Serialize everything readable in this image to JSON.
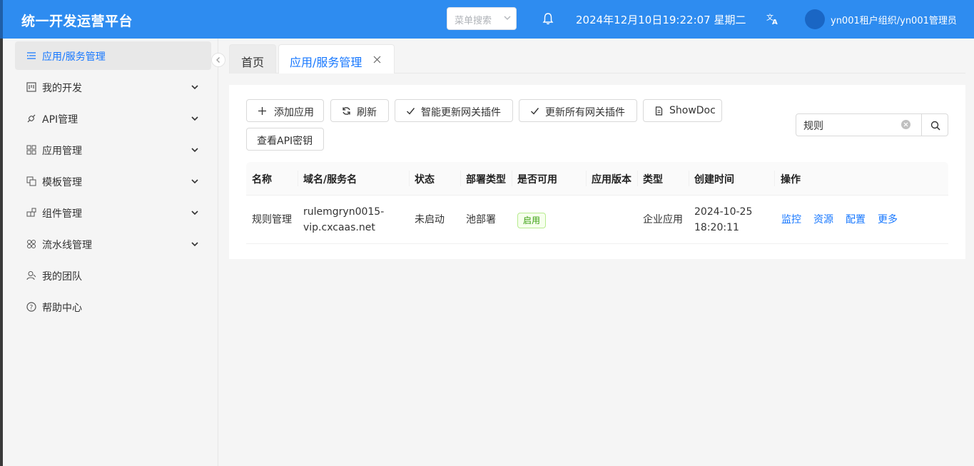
{
  "header": {
    "brand": "统一开发运营平台",
    "menu_search_placeholder": "菜单搜索",
    "datetime": "2024年12月10日19:22:07 星期二",
    "user": "yn001租户组织/yn001管理员"
  },
  "sidebar": {
    "items": [
      {
        "label": "应用/服务管理",
        "icon": "list-icon"
      },
      {
        "label": "我的开发",
        "icon": "board-icon"
      },
      {
        "label": "API管理",
        "icon": "api-icon"
      },
      {
        "label": "应用管理",
        "icon": "grid-icon"
      },
      {
        "label": "模板管理",
        "icon": "copy-icon"
      },
      {
        "label": "组件管理",
        "icon": "component-icon"
      },
      {
        "label": "流水线管理",
        "icon": "pipeline-icon"
      },
      {
        "label": "我的团队",
        "icon": "team-icon"
      },
      {
        "label": "帮助中心",
        "icon": "help-icon"
      }
    ]
  },
  "tabs": [
    {
      "label": "首页"
    },
    {
      "label": "应用/服务管理"
    }
  ],
  "toolbar": {
    "add": "添加应用",
    "refresh": "刷新",
    "smart_update": "智能更新网关插件",
    "update_all": "更新所有网关插件",
    "showdoc": "ShowDoc",
    "view_key": "查看API密钥"
  },
  "search": {
    "value": "规则"
  },
  "table": {
    "columns": [
      "名称",
      "域名/服务名",
      "状态",
      "部署类型",
      "是否可用",
      "应用版本",
      "类型",
      "创建时间",
      "操作"
    ],
    "rows": [
      {
        "name": "规则管理",
        "domain_line1": "rulemgryn0015-",
        "domain_line2": "vip.cxcaas.net",
        "status": "未启动",
        "deploy": "池部署",
        "available": "启用",
        "version": "",
        "type": "企业应用",
        "created_line1": "2024-10-25",
        "created_line2": "18:20:11",
        "ops": [
          "监控",
          "资源",
          "配置",
          "更多"
        ]
      }
    ]
  },
  "colors": {
    "header": "#2e8cf0",
    "accent": "#1677ff",
    "tag_green": "#389e0d"
  }
}
